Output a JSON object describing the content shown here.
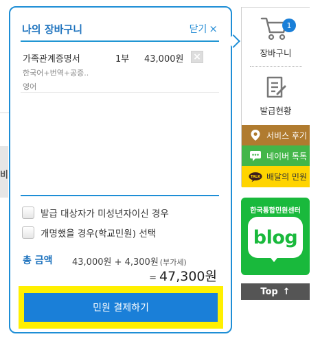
{
  "cart": {
    "title": "나의 장바구니",
    "close_label": "닫기",
    "close_icon": "×",
    "item": {
      "name": "가족관계증명서",
      "qty": "1부",
      "price": "43,000원",
      "options_line1": "한국어+번역+공증..",
      "options_line2": "영어",
      "remove_icon": "×"
    },
    "checks": [
      {
        "label": "발급 대상자가 미성년자이신 경우"
      },
      {
        "label": "개명했을 경우(학교민원) 선택"
      }
    ],
    "total": {
      "label": "총 금액",
      "breakdown": "43,000원 + 4,300원",
      "vat_note": "(부가세)",
      "equals": "=",
      "amount": "47,300원"
    },
    "pay_button": "민원 결제하기"
  },
  "quick_menu": {
    "cart_badge": "1",
    "cart_label": "장바구니",
    "status_label": "발급현황",
    "review_label": "서비스 후기",
    "kakao_label": "네이버 톡톡",
    "baemin_icon_text": "TALK",
    "baemin_label": "배달의 민원"
  },
  "blog_banner": {
    "title": "한국통합민원센터",
    "word": "blog"
  },
  "top_button": {
    "label": "Top",
    "arrow": "↑"
  },
  "background": {
    "side_glyph": "비"
  },
  "colors": {
    "accent_blue": "#1a7fd8",
    "highlight_yellow": "#fff000",
    "blog_green": "#19b93c",
    "review_brown": "#b07b2f",
    "kakao_green": "#43b649",
    "baemin_yellow": "#ffd400"
  }
}
